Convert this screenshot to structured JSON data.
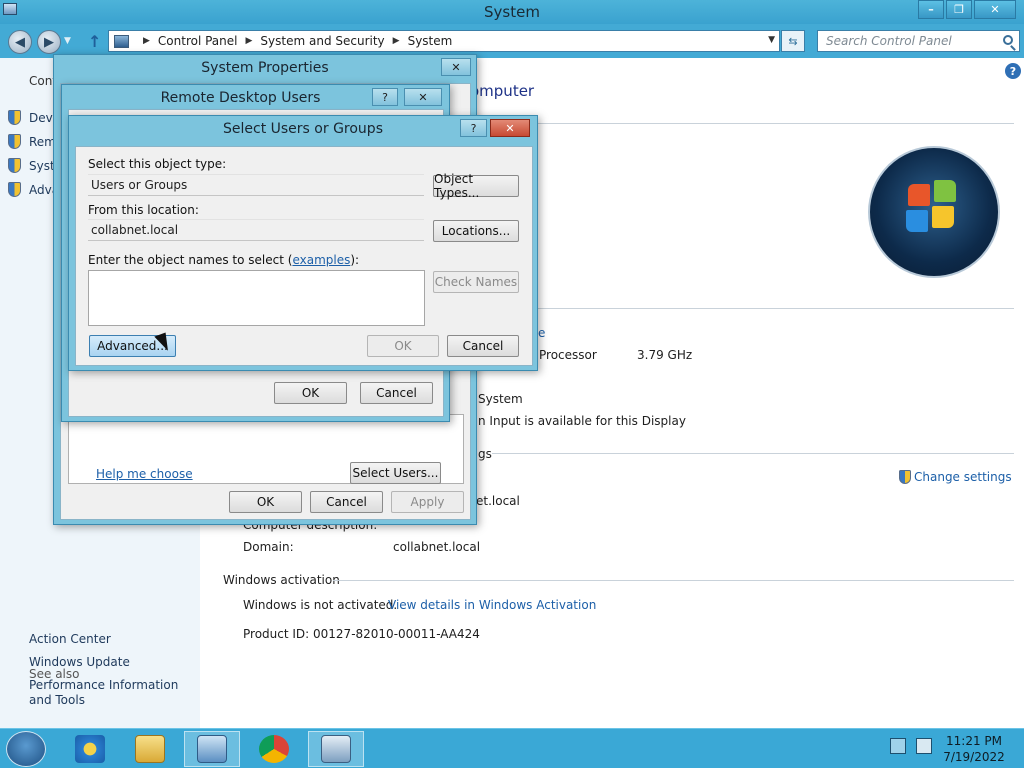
{
  "window": {
    "title": "System"
  },
  "nav": {
    "breadcrumbs": [
      "Control Panel",
      "System and Security",
      "System"
    ],
    "search_placeholder": "Search Control Panel"
  },
  "sidebar": {
    "heading": "Cont",
    "links": [
      "Devi",
      "Rem",
      "Syste",
      "Adva"
    ],
    "see_also": "See also",
    "see_also_links": [
      "Action Center",
      "Windows Update",
      "Performance Information and Tools"
    ]
  },
  "content": {
    "heading": "omputer",
    "processor_label": "Processor",
    "processor_speed": "3.79 GHz",
    "system_type_tail": "System",
    "pen_touch_tail": "n Input is available for this Display",
    "settings_tail": "gs",
    "change_settings": "Change settings",
    "computer_name_tail": "et.local",
    "computer_desc_partial": "Computer description:",
    "domain_label": "Domain:",
    "domain_value": "collabnet.local",
    "activation_title": "Windows activation",
    "activation_status": "Windows is not activated.",
    "activation_link": "View details in Windows Activation",
    "product_id": "Product ID: 00127-82010-00011-AA424",
    "ms_link_tail": "e"
  },
  "system_properties": {
    "title": "System Properties",
    "help_link": "Help me choose",
    "select_users": "Select Users...",
    "ok": "OK",
    "cancel": "Cancel",
    "apply": "Apply"
  },
  "remote_desktop_users": {
    "title": "Remote Desktop Users",
    "ok": "OK",
    "cancel": "Cancel"
  },
  "select_users": {
    "title": "Select Users or Groups",
    "object_type_label": "Select this object type:",
    "object_type_value": "Users or Groups",
    "object_types_btn": "Object Types...",
    "location_label": "From this location:",
    "location_value": "collabnet.local",
    "locations_btn": "Locations...",
    "names_label_pre": "Enter the object names to select (",
    "names_label_link": "examples",
    "names_label_post": "):",
    "check_names_btn": "Check Names",
    "advanced_btn": "Advanced...",
    "ok": "OK",
    "cancel": "Cancel"
  },
  "taskbar": {
    "time": "11:21 PM",
    "date": "7/19/2022"
  }
}
